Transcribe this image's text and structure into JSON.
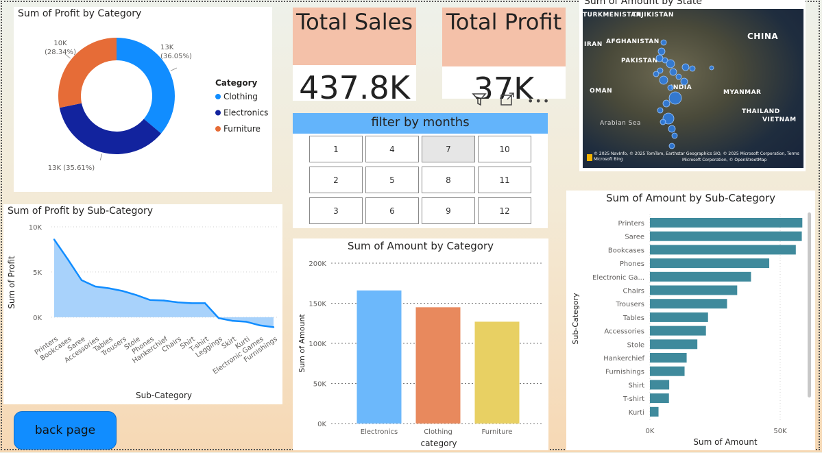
{
  "kpis": {
    "sales_title": "Total Sales",
    "sales_value": "437.8K",
    "profit_title": "Total Profit",
    "profit_value": "37K"
  },
  "header_icons": [
    "filter-icon",
    "focus-mode-icon",
    "more-options-icon"
  ],
  "filter": {
    "title": "filter by months",
    "months": [
      "1",
      "4",
      "7",
      "10",
      "2",
      "5",
      "8",
      "11",
      "3",
      "6",
      "9",
      "12"
    ],
    "selected": "7"
  },
  "back_button": {
    "label": "back page"
  },
  "map": {
    "title": "Sum of Amount by State",
    "labels": [
      "TURKMENISTAN",
      "TAJIKISTAN",
      "CHINA",
      "IRAN",
      "AFGHANISTAN",
      "PAKISTAN",
      "OMAN",
      "INDIA",
      "MYANMAR",
      "THAILAND",
      "VIETNAM",
      "Arabian Sea"
    ],
    "attribution1": "© 2025 NavInfo, © 2025 TomTom, Earthstar Geographics SIO, © 2025 Microsoft Corporation, Terms",
    "attribution2": "Microsoft Bing",
    "attribution3": "Microsoft Corporation, © OpenStreetMap",
    "bubbles": [
      [
        118,
        49,
        4
      ],
      [
        115,
        62,
        5
      ],
      [
        112,
        72,
        5
      ],
      [
        120,
        75,
        4
      ],
      [
        128,
        80,
        6
      ],
      [
        150,
        85,
        5
      ],
      [
        113,
        90,
        4
      ],
      [
        132,
        92,
        5
      ],
      [
        107,
        95,
        4
      ],
      [
        140,
        99,
        4
      ],
      [
        118,
        104,
        6
      ],
      [
        148,
        106,
        5
      ],
      [
        128,
        115,
        4
      ],
      [
        135,
        130,
        9
      ],
      [
        122,
        138,
        5
      ],
      [
        113,
        148,
        4
      ],
      [
        125,
        160,
        8
      ],
      [
        117,
        165,
        4
      ],
      [
        130,
        175,
        5
      ],
      [
        134,
        185,
        4
      ],
      [
        130,
        200,
        4
      ],
      [
        188,
        86,
        3
      ],
      [
        160,
        87,
        4
      ]
    ]
  },
  "chart_data": [
    {
      "type": "pie",
      "title": "Sum of Profit by Category",
      "legend_title": "Category",
      "legend_position": "right",
      "categories": [
        "Clothing",
        "Electronics",
        "Furniture"
      ],
      "values": [
        13300,
        13100,
        10400
      ],
      "labels": [
        "13K (36.05%)",
        "13K (35.61%)",
        "10K (28.34%)"
      ],
      "percents": [
        36.05,
        35.61,
        28.34
      ],
      "colors": [
        "#118dff",
        "#12239e",
        "#e66c37"
      ]
    },
    {
      "type": "area",
      "title": "Sum of Profit by Sub-Category",
      "xlabel": "Sub-Category",
      "ylabel": "Sum of Profit",
      "categories": [
        "Printers",
        "Bookcases",
        "Saree",
        "Accessories",
        "Tables",
        "Trousers",
        "Stole",
        "Phones",
        "Hankerchief",
        "Chairs",
        "Shirt",
        "T-shirt",
        "Leggings",
        "Skirt",
        "Kurti",
        "Electronic Games",
        "Furnishings"
      ],
      "values": [
        8600,
        6400,
        4100,
        3400,
        3200,
        2900,
        2450,
        1900,
        1850,
        1650,
        1550,
        1550,
        -100,
        -400,
        -500,
        -900,
        -1100
      ],
      "ylim": [
        -1300,
        10000
      ],
      "yticks": [
        "0K",
        "5K",
        "10K"
      ],
      "ytick_values": [
        0,
        5000,
        10000
      ],
      "color": "#118dff"
    },
    {
      "type": "bar",
      "title": "Sum of Amount by Category",
      "xlabel": "category",
      "ylabel": "Sum of Amount",
      "categories": [
        "Electronics",
        "Clothing",
        "Furniture"
      ],
      "values": [
        166000,
        145000,
        127000
      ],
      "colors": [
        "#6cb8fb",
        "#e8895d",
        "#e8d063"
      ],
      "ylim": [
        0,
        200000
      ],
      "yticks": [
        "0K",
        "50K",
        "100K",
        "150K",
        "200K"
      ],
      "ytick_values": [
        0,
        50000,
        100000,
        150000,
        200000
      ]
    },
    {
      "type": "bar",
      "orientation": "horizontal",
      "title": "Sum of Amount by Sub-Category",
      "xlabel": "Sum of Amount",
      "ylabel": "Sub-Category",
      "categories": [
        "Printers",
        "Saree",
        "Bookcases",
        "Phones",
        "Electronic Ga...",
        "Chairs",
        "Trousers",
        "Tables",
        "Accessories",
        "Stole",
        "Hankerchief",
        "Furnishings",
        "Shirt",
        "T-shirt",
        "Kurti"
      ],
      "values": [
        58500,
        58300,
        56000,
        45800,
        38800,
        33500,
        29600,
        22300,
        21500,
        18200,
        14100,
        13300,
        7400,
        7300,
        3300
      ],
      "color": "#3f8a9c",
      "xlim": [
        0,
        60000
      ],
      "xticks": [
        "0K",
        "50K"
      ],
      "xtick_values": [
        0,
        50000
      ]
    }
  ]
}
